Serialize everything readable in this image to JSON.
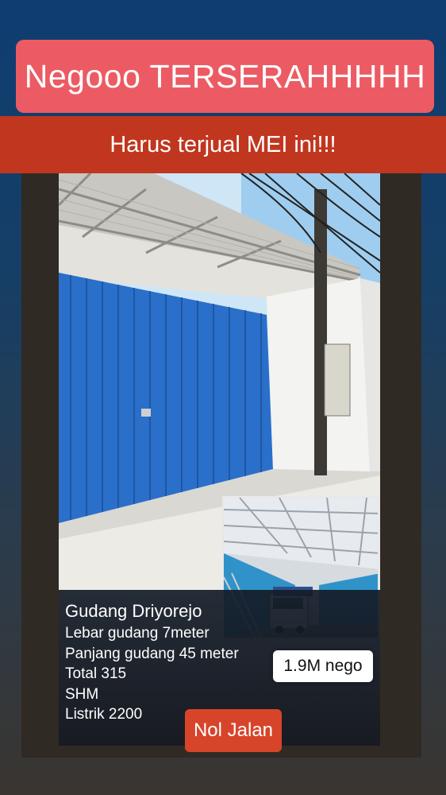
{
  "headline": "Negooo TERSERAHHHHH",
  "subheadline": "Harus terjual MEI ini!!!",
  "listing": {
    "name": "Gudang Driyorejo",
    "details": [
      "Lebar gudang 7meter",
      "Panjang gudang 45 meter",
      "Total 315",
      "SHM",
      "Listrik 2200"
    ],
    "price": "1.9M nego",
    "access": "Nol Jalan"
  },
  "colors": {
    "headline_bg": "#ec5b63",
    "subheadline_bg": "#c1361f",
    "access_bg": "#d8442a",
    "shutter": "#2a6fc9"
  }
}
